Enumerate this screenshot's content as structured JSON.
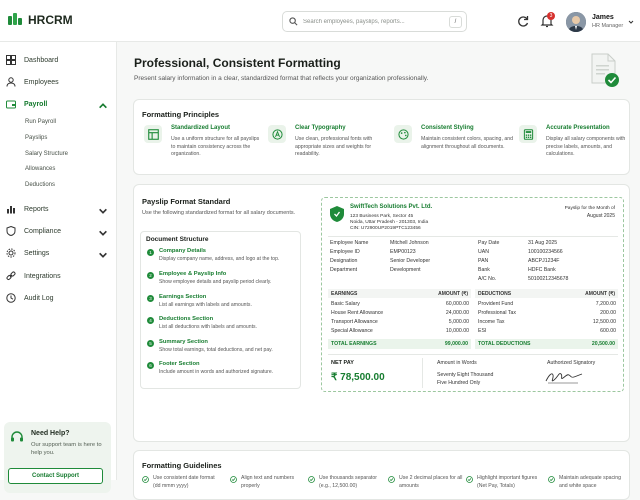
{
  "app": {
    "name": "HRCRM",
    "brand_color": "#1f8b3a"
  },
  "search": {
    "placeholder": "Search employees, payslips, reports...",
    "shortcut": "/"
  },
  "notifications": {
    "count": "3"
  },
  "user": {
    "name": "James",
    "role": "HR Manager"
  },
  "sidebar": {
    "items": [
      {
        "label": "Dashboard",
        "icon": "dashboard-icon"
      },
      {
        "label": "Employees",
        "icon": "users-icon"
      },
      {
        "label": "Payroll",
        "icon": "wallet-icon"
      },
      {
        "label": "Reports",
        "icon": "chart-icon"
      },
      {
        "label": "Compliance",
        "icon": "shield-icon"
      },
      {
        "label": "Settings",
        "icon": "gear-icon"
      },
      {
        "label": "Integrations",
        "icon": "link-icon"
      },
      {
        "label": "Audit Log",
        "icon": "clock-icon"
      }
    ],
    "payroll_sub": [
      "Run Payroll",
      "Payslips",
      "Salary Structure",
      "Allowances",
      "Deductions"
    ]
  },
  "help": {
    "title": "Need Help?",
    "text": "Our support team is here to help you.",
    "button": "Contact Support"
  },
  "page": {
    "title": "Professional, Consistent Formatting",
    "subtitle": "Present salary information in a clear, standardized format that reflects your organization professionally."
  },
  "principles": {
    "title": "Formatting Principles",
    "items": [
      {
        "title": "Standardized Layout",
        "desc": "Use a uniform structure for all payslips to maintain consistency across the organization.",
        "icon": "layout-icon"
      },
      {
        "title": "Clear Typography",
        "desc": "Use clean, professional fonts with appropriate sizes and weights for readability.",
        "icon": "typography-icon"
      },
      {
        "title": "Consistent Styling",
        "desc": "Maintain consistent colors, spacing, and alignment throughout all documents.",
        "icon": "palette-icon"
      },
      {
        "title": "Accurate Presentation",
        "desc": "Display all salary components with precise labels, amounts, and calculations.",
        "icon": "calculator-icon"
      }
    ]
  },
  "standard": {
    "title": "Payslip Format Standard",
    "subtitle": "Use the following standardized format for all salary documents.",
    "structure_title": "Document Structure",
    "items": [
      {
        "num": "1",
        "name": "Company Details",
        "desc": "Display company name, address, and logo at the top."
      },
      {
        "num": "2",
        "name": "Employee & Payslip Info",
        "desc": "Show employee details and payslip period clearly."
      },
      {
        "num": "3",
        "name": "Earnings Section",
        "desc": "List all earnings with labels and amounts."
      },
      {
        "num": "4",
        "name": "Deductions Section",
        "desc": "List all deductions with labels and amounts."
      },
      {
        "num": "5",
        "name": "Summary Section",
        "desc": "Show total earnings, total deductions, and net pay."
      },
      {
        "num": "6",
        "name": "Footer Section",
        "desc": "Include amount in words and authorized signature."
      }
    ]
  },
  "payslip": {
    "company": "SwiftTech Solutions Pvt. Ltd.",
    "addr1": "123 Business Park, Sector 45",
    "addr2": "Noida, Uttar Pradesh - 201303, India",
    "cin": "CIN: U72900UP2019PTC123456",
    "month_label": "Payslip for the Month of",
    "month": "August 2025",
    "left_info": [
      [
        "Employee Name",
        "Mitchell Johnson"
      ],
      [
        "Employee ID",
        "EMP00123"
      ],
      [
        "Designation",
        "Senior Developer"
      ],
      [
        "Department",
        "Development"
      ]
    ],
    "right_info": [
      [
        "Pay Date",
        "31 Aug 2025"
      ],
      [
        "UAN",
        "100100234566"
      ],
      [
        "PAN",
        "ABCPJ1234F"
      ],
      [
        "Bank",
        "HDFC Bank"
      ],
      [
        "A/C No.",
        "50100212345678"
      ]
    ],
    "earn_head": [
      "EARNINGS",
      "AMOUNT (₹)"
    ],
    "ded_head": [
      "DEDUCTIONS",
      "AMOUNT (₹)"
    ],
    "earnings": [
      [
        "Basic Salary",
        "60,000.00"
      ],
      [
        "House Rent Allowance",
        "24,000.00"
      ],
      [
        "Transport Allowance",
        "5,000.00"
      ],
      [
        "Special Allowance",
        "10,000.00"
      ]
    ],
    "deductions": [
      [
        "Provident Fund",
        "7,200.00"
      ],
      [
        "Professional Tax",
        "200.00"
      ],
      [
        "Income Tax",
        "12,500.00"
      ],
      [
        "ESI",
        "600.00"
      ]
    ],
    "total_earn": [
      "TOTAL EARNINGS",
      "99,000.00"
    ],
    "total_ded": [
      "TOTAL DEDUCTIONS",
      "20,500.00"
    ],
    "net_label": "NET PAY",
    "net_value": "₹ 78,500.00",
    "words_label": "Amount in Words",
    "words": [
      "Seventy Eight Thousand",
      "Five Hundred Only"
    ],
    "signatory": "Authorized Signatory"
  },
  "guidelines": {
    "title": "Formatting Guidelines",
    "items": [
      "Use consistent date format (dd mmm yyyy)",
      "Align text and numbers properly",
      "Use thousands separator (e.g., 12,500.00)",
      "Use 2 decimal places for all amounts",
      "Highlight important figures (Net Pay, Totals)",
      "Maintain adequate spacing and white space"
    ]
  }
}
